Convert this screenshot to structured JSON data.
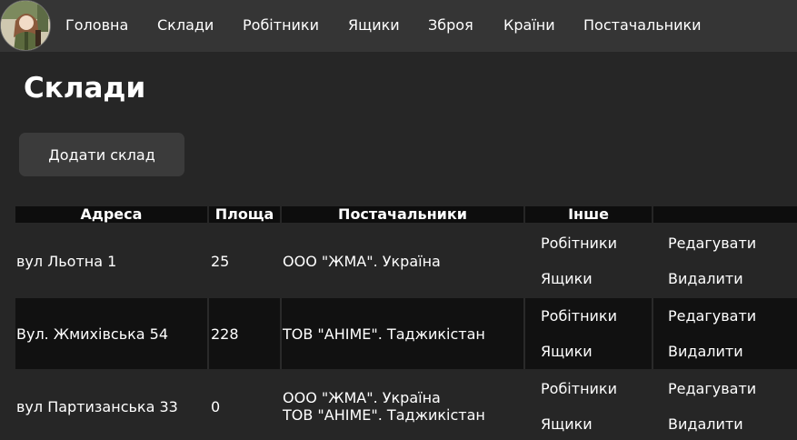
{
  "nav": {
    "items": [
      "Головна",
      "Склади",
      "Робітники",
      "Ящики",
      "Зброя",
      "Країни",
      "Постачальники"
    ]
  },
  "page": {
    "title": "Склади",
    "add_button_label": "Додати склад"
  },
  "table": {
    "headers": [
      "Адреса",
      "Площа",
      "Постачальники",
      "Інше",
      ""
    ],
    "rows": [
      {
        "address": "вул Льотна 1",
        "area": "25",
        "suppliers": [
          "ООО \"ЖМА\". Україна"
        ],
        "workers_link": "Робітники",
        "boxes_link": "Ящики",
        "edit_link": "Редагувати",
        "delete_link": "Видалити"
      },
      {
        "address": "Вул. Жмихівська 54",
        "area": "228",
        "suppliers": [
          "ТОВ \"АНІМЕ\". Таджикістан"
        ],
        "workers_link": "Робітники",
        "boxes_link": "Ящики",
        "edit_link": "Редагувати",
        "delete_link": "Видалити"
      },
      {
        "address": "вул Партизанська 33",
        "area": "0",
        "suppliers": [
          "ООО \"ЖМА\". Україна",
          "ТОВ \"АНІМЕ\". Таджикістан"
        ],
        "workers_link": "Робітники",
        "boxes_link": "Ящики",
        "edit_link": "Редагувати",
        "delete_link": "Видалити"
      }
    ]
  }
}
